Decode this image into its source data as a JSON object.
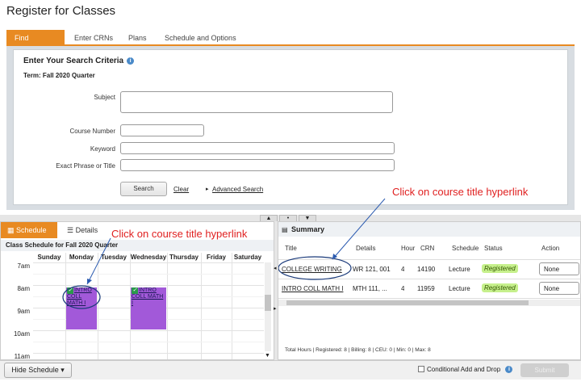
{
  "page": {
    "title": "Register for Classes"
  },
  "tabs": [
    {
      "label": "Find Classes",
      "active": true
    },
    {
      "label": "Enter CRNs",
      "active": false
    },
    {
      "label": "Plans",
      "active": false
    },
    {
      "label": "Schedule and Options",
      "active": false
    }
  ],
  "search": {
    "heading": "Enter Your Search Criteria",
    "term": "Term: Fall 2020 Quarter",
    "subject_label": "Subject",
    "course_number_label": "Course Number",
    "keyword_label": "Keyword",
    "exact_phrase_label": "Exact Phrase or Title",
    "search_button": "Search",
    "clear_link": "Clear",
    "advanced_link": "Advanced Search"
  },
  "annotations": {
    "summary_note": "Click on course title hyperlink",
    "schedule_note": "Click on course title hyperlink"
  },
  "schedule": {
    "tab_schedule": "Schedule",
    "tab_details": "Details",
    "title": "Class Schedule for Fall 2020 Quarter",
    "days": [
      "Sunday",
      "Monday",
      "Tuesday",
      "Wednesday",
      "Thursday",
      "Friday",
      "Saturday"
    ],
    "times": [
      "7am",
      "8am",
      "9am",
      "10am",
      "11am"
    ],
    "events": [
      {
        "day": "Monday",
        "label": "INTRO COLL MATH I"
      },
      {
        "day": "Wednesday",
        "label": "INTRO COLL MATH I"
      }
    ]
  },
  "summary": {
    "header": "Summary",
    "columns": [
      "Title",
      "Details",
      "Hour",
      "CRN",
      "Schedule",
      "Status",
      "Action"
    ],
    "rows": [
      {
        "title": "COLLEGE WRITING",
        "details": "WR 121, 001",
        "hours": "4",
        "crn": "14190",
        "schedule": "Lecture",
        "status": "Registered",
        "action": "None"
      },
      {
        "title": "INTRO COLL MATH I",
        "details": "MTH 111, ...",
        "hours": "4",
        "crn": "11959",
        "schedule": "Lecture",
        "status": "Registered",
        "action": "None"
      }
    ],
    "totals": "Total Hours | Registered: 8 | Billing: 8 | CEU: 0 | Min: 0 | Max: 8"
  },
  "bottom": {
    "hide_schedule": "Hide Schedule ▾",
    "conditional_label": "Conditional Add and Drop",
    "submit": "Submit"
  },
  "colors": {
    "accent": "#e88a22",
    "event": "#a259d9",
    "status": "#c6f08c",
    "annotation": "#e02020"
  }
}
